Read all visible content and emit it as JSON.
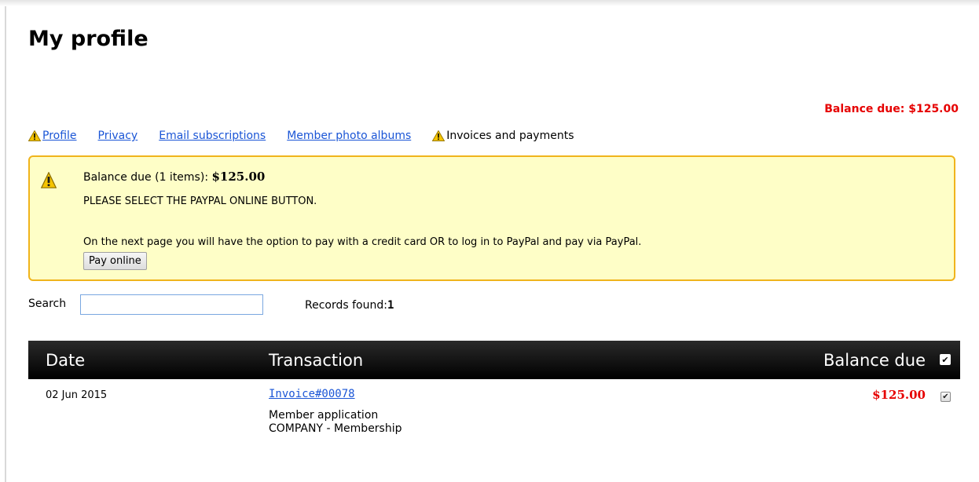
{
  "page": {
    "title": "My profile",
    "balance_due_top": "Balance due: $125.00"
  },
  "tabs": [
    {
      "label": "Profile",
      "warning": true,
      "link": true
    },
    {
      "label": "Privacy",
      "warning": false,
      "link": true
    },
    {
      "label": "Email subscriptions",
      "warning": false,
      "link": true
    },
    {
      "label": "Member photo albums",
      "warning": false,
      "link": true
    },
    {
      "label": "Invoices and payments",
      "warning": true,
      "link": false
    }
  ],
  "notice": {
    "balance_prefix": "Balance due (1 items): ",
    "balance_amount": "$125.00",
    "instruction": "PLEASE SELECT THE PAYPAL ONLINE BUTTON.",
    "detail": "On the next page you will have the option to pay with a credit card OR to log in to PayPal and pay via PayPal.",
    "pay_button": "Pay online"
  },
  "search": {
    "label": "Search",
    "value": "",
    "placeholder": ""
  },
  "records": {
    "label": "Records found:",
    "count": "1"
  },
  "table": {
    "headers": {
      "date": "Date",
      "transaction": "Transaction",
      "balance_due": "Balance due"
    },
    "header_checked": true,
    "rows": [
      {
        "date": "02 Jun 2015",
        "invoice": "Invoice#00078",
        "description": "Member application",
        "subtitle": "COMPANY - Membership",
        "amount": "$125.00",
        "checked": true
      }
    ]
  },
  "colors": {
    "alert_red": "#e60000",
    "link_blue": "#1a55d6",
    "notice_bg": "#fefec7",
    "notice_border": "#f0b41c",
    "header_bg": "#000000"
  }
}
